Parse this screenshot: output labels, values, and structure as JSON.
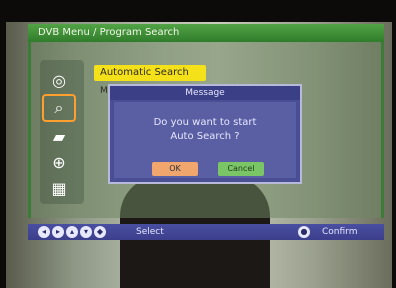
{
  "osd": {
    "title": "DVB Menu / Program Search",
    "menu_item_selected": "Automatic Search",
    "menu_item_partial": "Ma"
  },
  "icons": [
    {
      "name": "globe-icon",
      "glyph": "◎"
    },
    {
      "name": "search-icon",
      "glyph": "⌕"
    },
    {
      "name": "folder-icon",
      "glyph": "▰"
    },
    {
      "name": "satellite-icon",
      "glyph": "⊕"
    },
    {
      "name": "grid-icon",
      "glyph": "▦"
    }
  ],
  "dialog": {
    "title": "Message",
    "text_line1": "Do you want to start",
    "text_line2": "Auto Search ?",
    "ok_label": "OK",
    "cancel_label": "Cancel"
  },
  "hint_bar": {
    "keys": [
      "◂",
      "▸",
      "▴",
      "▾",
      "◆"
    ],
    "select_label": "Select",
    "confirm_key": "●",
    "confirm_label": "Confirm"
  },
  "colors": {
    "title_green": "#3d7b39",
    "highlight_yellow": "#f5e11a",
    "dialog_blue": "#4a4e95",
    "ok_orange": "#f0a66d",
    "cancel_green": "#7ac565"
  }
}
